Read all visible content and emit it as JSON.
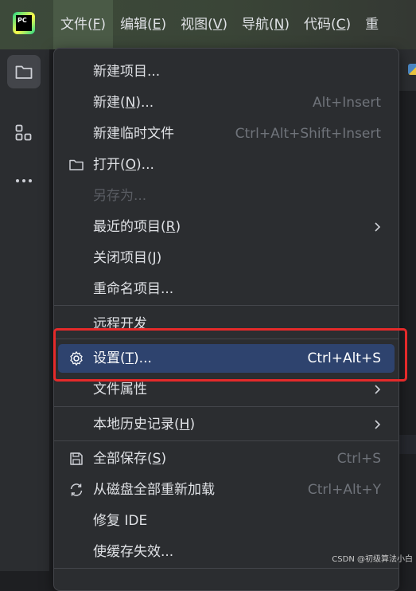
{
  "app": {
    "logo_text": "PC"
  },
  "menubar": [
    {
      "label": "文件(",
      "mn": "F",
      "tail": ")"
    },
    {
      "label": "编辑(",
      "mn": "E",
      "tail": ")"
    },
    {
      "label": "视图(",
      "mn": "V",
      "tail": ")"
    },
    {
      "label": "导航(",
      "mn": "N",
      "tail": ")"
    },
    {
      "label": "代码(",
      "mn": "C",
      "tail": ")"
    },
    {
      "label": "重",
      "mn": "",
      "tail": ""
    }
  ],
  "menu": {
    "new_project": "新建项目...",
    "new_pre": "新建(",
    "new_mn": "N",
    "new_post": ")...",
    "new_shortcut": "Alt+Insert",
    "scratch": "新建临时文件",
    "scratch_shortcut": "Ctrl+Alt+Shift+Insert",
    "open_pre": "打开(",
    "open_mn": "O",
    "open_post": ")...",
    "save_as": "另存为...",
    "recent_pre": "最近的项目(",
    "recent_mn": "R",
    "recent_post": ")",
    "close_pre": "关闭项目(",
    "close_mn": "J",
    "close_post": ")",
    "rename": "重命名项目...",
    "remote": "远程开发",
    "settings_pre": "设置(",
    "settings_mn": "T",
    "settings_post": ")...",
    "settings_shortcut": "Ctrl+Alt+S",
    "file_props": "文件属性",
    "history_pre": "本地历史记录(",
    "history_mn": "H",
    "history_post": ")",
    "save_all_pre": "全部保存(",
    "save_all_mn": "S",
    "save_all_post": ")",
    "save_all_shortcut": "Ctrl+S",
    "reload": "从磁盘全部重新加载",
    "reload_shortcut": "Ctrl+Alt+Y",
    "repair": "修复 IDE",
    "invalidate": "使缓存失效..."
  },
  "watermark": "CSDN @初级算法小白",
  "colors": {
    "selected_bg": "#2e436e",
    "highlight_border": "#e52a2a"
  }
}
